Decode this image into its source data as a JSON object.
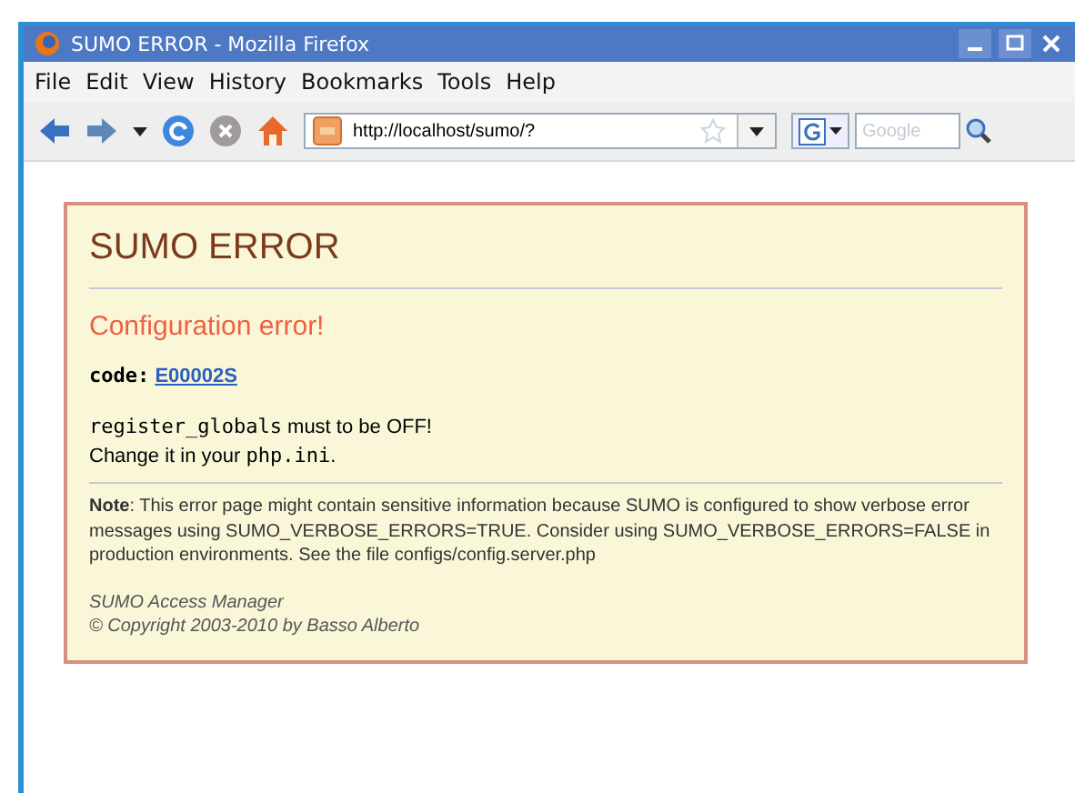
{
  "window": {
    "title": "SUMO ERROR - Mozilla Firefox"
  },
  "menu": [
    "File",
    "Edit",
    "View",
    "History",
    "Bookmarks",
    "Tools",
    "Help"
  ],
  "address": {
    "value": "http://localhost/sumo/?"
  },
  "search": {
    "placeholder": "Google"
  },
  "error": {
    "title": "SUMO ERROR",
    "heading": "Configuration error!",
    "code_label": "code:",
    "code": "E00002S",
    "messages": [
      [
        {
          "kind": "code",
          "text": "register_globals"
        },
        {
          "kind": "text",
          "text": " must to be OFF!"
        }
      ],
      [
        {
          "kind": "text",
          "text": "Change it in your "
        },
        {
          "kind": "code",
          "text": "php.ini"
        },
        {
          "kind": "text",
          "text": "."
        }
      ]
    ],
    "note": "**Note**: This error page might contain sensitive information because SUMO is configured to show verbose error messages using SUMO_VERBOSE_ERRORS=TRUE. Consider using SUMO_VERBOSE_ERRORS=FALSE in production environments. See the file configs/config.server.php",
    "footer": [
      "SUMO Access Manager",
      "© Copyright 2003-2010 by Basso Alberto"
    ]
  }
}
